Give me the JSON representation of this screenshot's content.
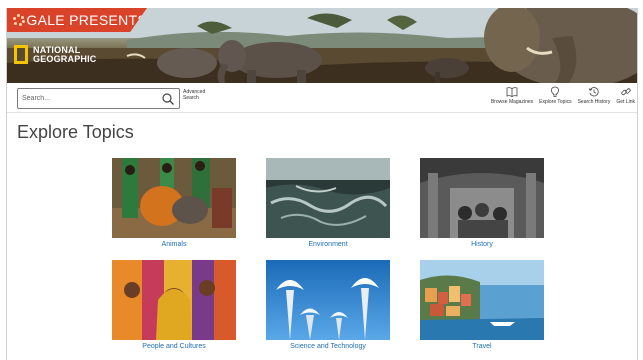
{
  "banner": {
    "brand": "GALE PRESENTS",
    "logo_line1": "NATIONAL",
    "logo_line2": "GEOGRAPHIC"
  },
  "toolbar": {
    "search_placeholder": "Search...",
    "advanced_search_line1": "Advanced",
    "advanced_search_line2": "Search",
    "tools": [
      {
        "label": "Browse Magazines",
        "icon": "book-icon"
      },
      {
        "label": "Explore Topics",
        "icon": "lightbulb-icon"
      },
      {
        "label": "Search History",
        "icon": "history-icon"
      },
      {
        "label": "Get Link",
        "icon": "link-icon"
      }
    ]
  },
  "main": {
    "title": "Explore Topics",
    "topics": [
      {
        "label": "Animals"
      },
      {
        "label": "Environment"
      },
      {
        "label": "History"
      },
      {
        "label": "People and Cultures"
      },
      {
        "label": "Science and Technology"
      },
      {
        "label": "Travel"
      }
    ]
  },
  "colors": {
    "brand_red": "#d9432a",
    "logo_yellow": "#f4c400",
    "link_blue": "#1f6fb5"
  }
}
